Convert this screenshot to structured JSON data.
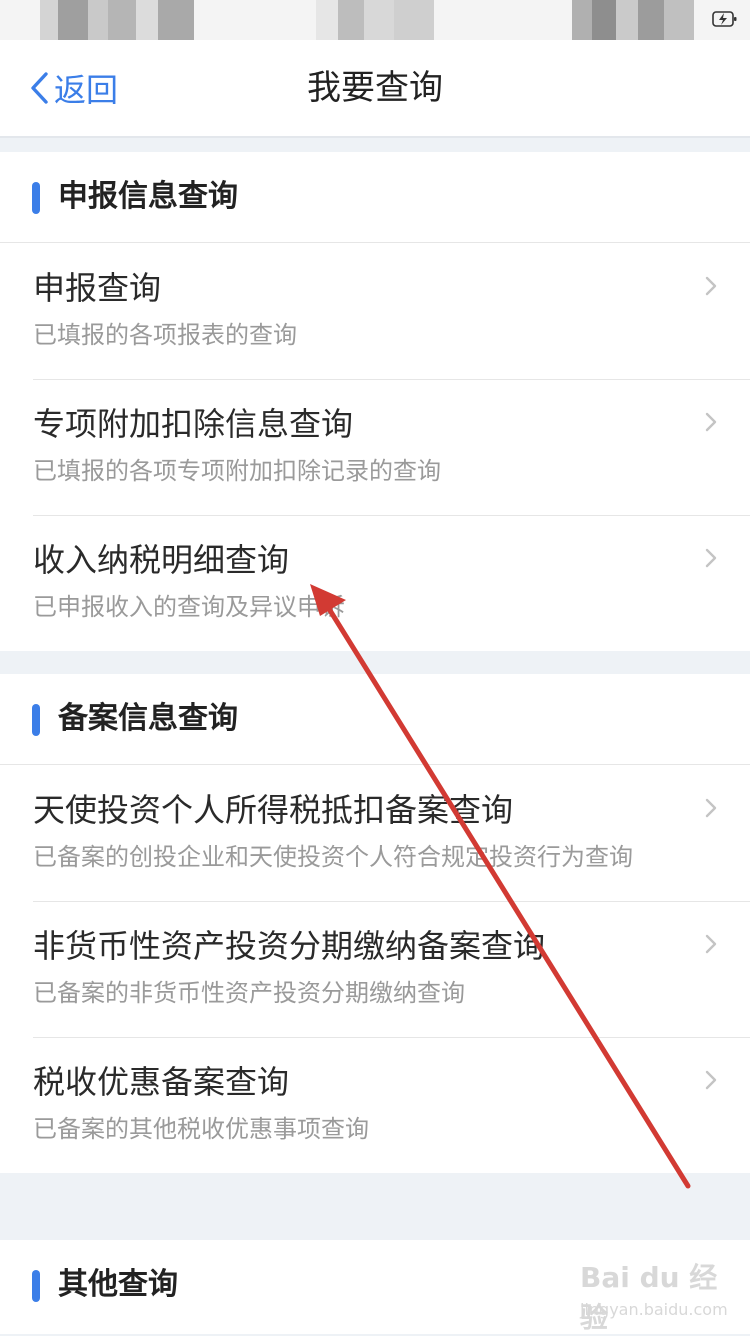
{
  "nav": {
    "back_label": "返回",
    "title": "我要查询"
  },
  "sections": [
    {
      "title": "申报信息查询",
      "items": [
        {
          "title": "申报查询",
          "sub": "已填报的各项报表的查询"
        },
        {
          "title": "专项附加扣除信息查询",
          "sub": "已填报的各项专项附加扣除记录的查询"
        },
        {
          "title": "收入纳税明细查询",
          "sub": "已申报收入的查询及异议申诉"
        }
      ]
    },
    {
      "title": "备案信息查询",
      "items": [
        {
          "title": "天使投资个人所得税抵扣备案查询",
          "sub": "已备案的创投企业和天使投资个人符合规定投资行为查询"
        },
        {
          "title": "非货币性资产投资分期缴纳备案查询",
          "sub": "已备案的非货币性资产投资分期缴纳查询"
        },
        {
          "title": "税收优惠备案查询",
          "sub": "已备案的其他税收优惠事项查询"
        }
      ]
    },
    {
      "title": "其他查询",
      "items": []
    }
  ],
  "watermark": {
    "brand": "Bai du 经验",
    "url": "jingyan.baidu.com"
  },
  "colors": {
    "accent": "#3b7ee8",
    "arrow": "#d23a33"
  }
}
